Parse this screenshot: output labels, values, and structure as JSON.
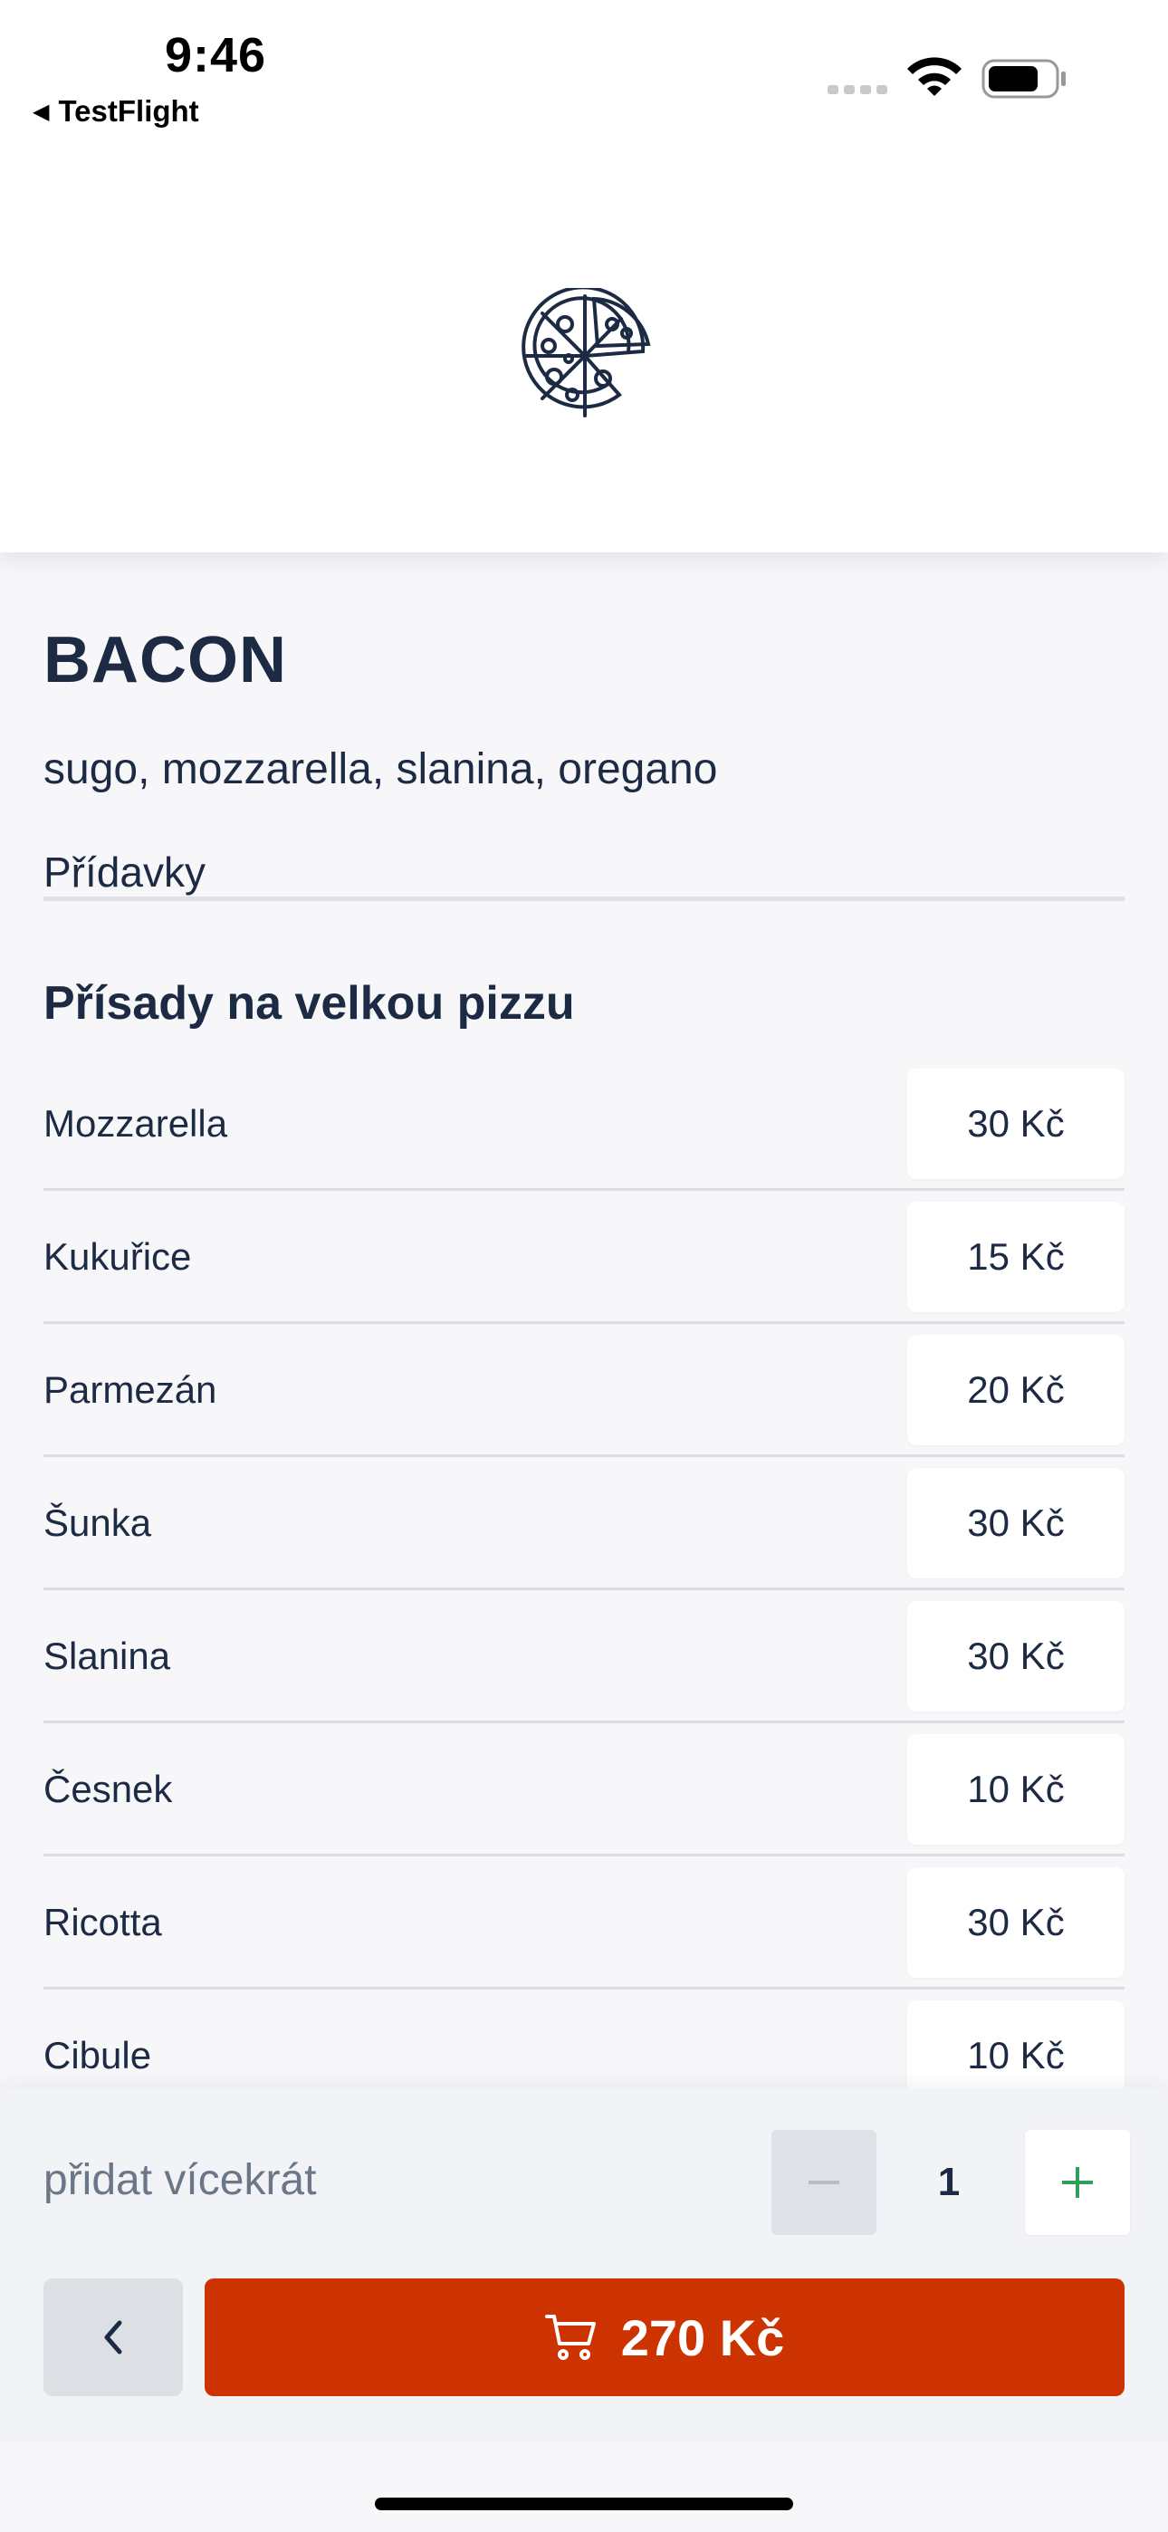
{
  "status_bar": {
    "time": "9:46",
    "back_app": "TestFlight",
    "icons": [
      "cellular-signal-icon",
      "wifi-icon",
      "battery-icon"
    ]
  },
  "header": {
    "logo_icon": "pizza-icon"
  },
  "product": {
    "name": "BACON",
    "ingredients": "sugo, mozzarella, slanina, oregano"
  },
  "tabs": {
    "extras": "Přídavky"
  },
  "section": {
    "title": "Přísady na velkou pizzu"
  },
  "toppings": [
    {
      "name": "Mozzarella",
      "price": "30 Kč"
    },
    {
      "name": "Kukuřice",
      "price": "15 Kč"
    },
    {
      "name": "Parmezán",
      "price": "20 Kč"
    },
    {
      "name": "Šunka",
      "price": "30 Kč"
    },
    {
      "name": "Slanina",
      "price": "30 Kč"
    },
    {
      "name": "Česnek",
      "price": "10 Kč"
    },
    {
      "name": "Ricotta",
      "price": "30 Kč"
    },
    {
      "name": "Cibule",
      "price": "10 Kč"
    }
  ],
  "quantity": {
    "label": "přidat vícekrát",
    "value": "1",
    "minus_icon": "minus-icon",
    "plus_icon": "plus-icon"
  },
  "actions": {
    "back_icon": "chevron-left-icon",
    "cart_icon": "cart-icon",
    "total": "270 Kč"
  },
  "colors": {
    "accent": "#cc3300",
    "text": "#1c2a44",
    "background": "#f7f7fa",
    "plus": "#2e9e5b"
  }
}
